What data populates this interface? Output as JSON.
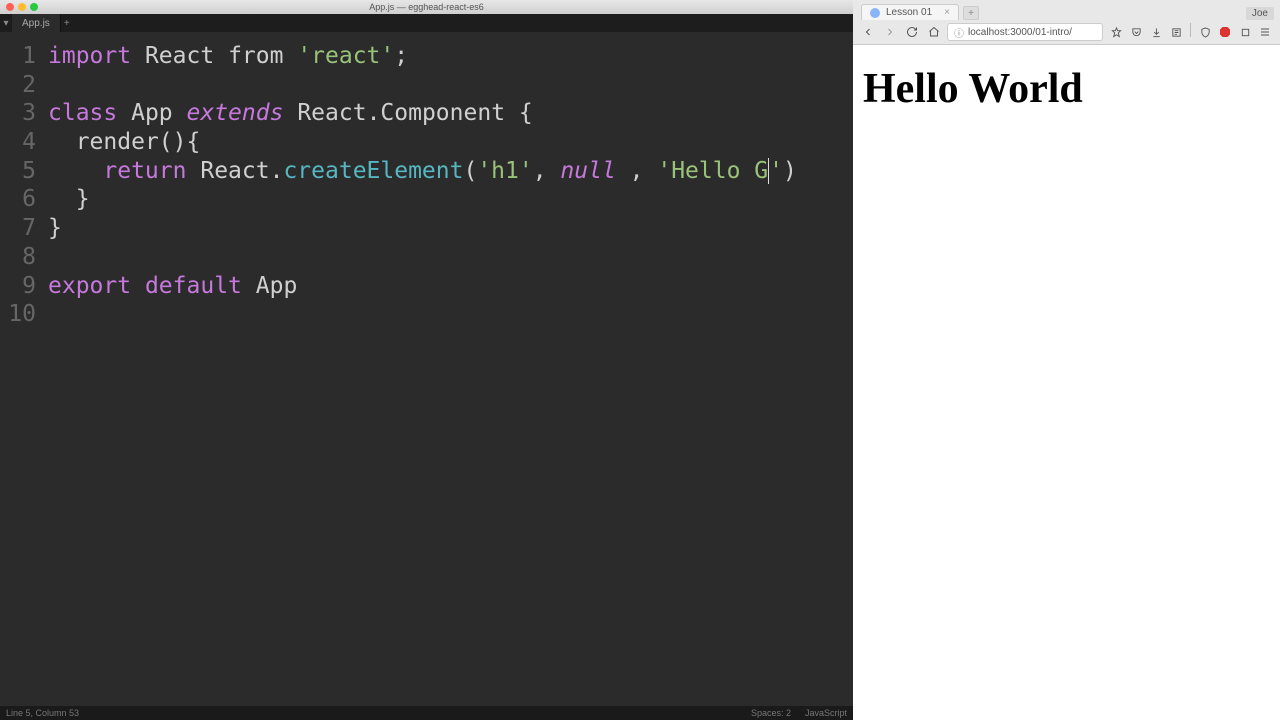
{
  "editor": {
    "window_title": "App.js — egghead-react-es6",
    "tabs": [
      {
        "label": "App.js",
        "active": true
      }
    ],
    "traffic_lights": [
      "close",
      "minimize",
      "zoom"
    ],
    "gutter_start": 1,
    "gutter_end": 10,
    "code_lines": [
      [
        {
          "cls": "k-import",
          "t": "import"
        },
        {
          "cls": "punc",
          "t": " "
        },
        {
          "cls": "ident",
          "t": "React"
        },
        {
          "cls": "punc",
          "t": " "
        },
        {
          "cls": "from",
          "t": "from"
        },
        {
          "cls": "punc",
          "t": " "
        },
        {
          "cls": "str",
          "t": "'react'"
        },
        {
          "cls": "punc",
          "t": ";"
        }
      ],
      [],
      [
        {
          "cls": "k-class",
          "t": "class"
        },
        {
          "cls": "punc",
          "t": " "
        },
        {
          "cls": "ident",
          "t": "App"
        },
        {
          "cls": "punc",
          "t": " "
        },
        {
          "cls": "k-extends",
          "t": "extends"
        },
        {
          "cls": "punc",
          "t": " "
        },
        {
          "cls": "ident",
          "t": "React"
        },
        {
          "cls": "dot-op",
          "t": "."
        },
        {
          "cls": "ident",
          "t": "Component"
        },
        {
          "cls": "punc",
          "t": " {"
        }
      ],
      [
        {
          "cls": "punc",
          "t": "  "
        },
        {
          "cls": "ident",
          "t": "render"
        },
        {
          "cls": "punc",
          "t": "(){"
        }
      ],
      [
        {
          "cls": "punc",
          "t": "    "
        },
        {
          "cls": "k-return",
          "t": "return"
        },
        {
          "cls": "punc",
          "t": " "
        },
        {
          "cls": "ident",
          "t": "React"
        },
        {
          "cls": "dot-op",
          "t": "."
        },
        {
          "cls": "func",
          "t": "createElement"
        },
        {
          "cls": "punc",
          "t": "("
        },
        {
          "cls": "str",
          "t": "'h1'"
        },
        {
          "cls": "punc",
          "t": ", "
        },
        {
          "cls": "null",
          "t": "null"
        },
        {
          "cls": "punc",
          "t": " , "
        },
        {
          "cls": "str",
          "t": "'Hello G"
        },
        {
          "cls": "str cursor",
          "t": ""
        },
        {
          "cls": "str",
          "t": "'"
        },
        {
          "cls": "punc",
          "t": ")"
        }
      ],
      [
        {
          "cls": "punc",
          "t": "  }"
        }
      ],
      [
        {
          "cls": "punc",
          "t": "}"
        }
      ],
      [],
      [
        {
          "cls": "k-export",
          "t": "export"
        },
        {
          "cls": "punc",
          "t": " "
        },
        {
          "cls": "k-default",
          "t": "default"
        },
        {
          "cls": "punc",
          "t": " "
        },
        {
          "cls": "ident",
          "t": "App"
        }
      ],
      []
    ],
    "statusbar": {
      "left": "Line 5, Column 53",
      "spaces": "Spaces: 2",
      "lang": "JavaScript"
    }
  },
  "browser": {
    "tab_title": "Lesson 01",
    "user_badge": "Joe",
    "url": "localhost:3000/01-intro/",
    "nav_icons": [
      "back",
      "forward",
      "reload",
      "home"
    ],
    "toolbar_right_icons": [
      "bookmark",
      "pocket",
      "downloads",
      "screenshot",
      "sep",
      "adblock",
      "save",
      "devtools",
      "menu"
    ],
    "page_heading": "Hello World"
  }
}
